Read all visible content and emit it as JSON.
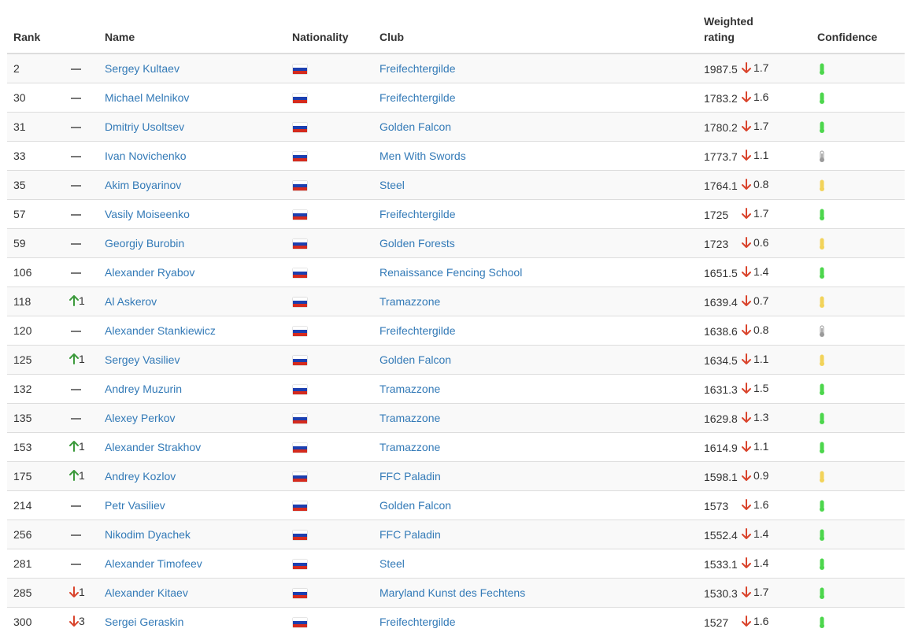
{
  "headers": {
    "rank": "Rank",
    "name": "Name",
    "nationality": "Nationality",
    "club": "Club",
    "weighted_line1": "Weighted",
    "weighted_line2": "rating",
    "confidence": "Confidence"
  },
  "colors": {
    "link": "#337ab7",
    "up": "#3c9a3c",
    "down": "#d9442c",
    "neutral": "#777777",
    "confidence_high": "#4cd64c",
    "confidence_medium": "#f2d35a",
    "confidence_unknown": "#9a9a9a"
  },
  "rows": [
    {
      "rank": "2",
      "change_dir": "none",
      "change": "",
      "name": "Sergey Kultaev",
      "flag": "russia-flag-icon",
      "club": "Freifechtergilde",
      "rating": "1987.5",
      "rating_change": "1.7",
      "confidence": "high"
    },
    {
      "rank": "30",
      "change_dir": "none",
      "change": "",
      "name": "Michael Melnikov",
      "flag": "russia-flag-icon",
      "club": "Freifechtergilde",
      "rating": "1783.2",
      "rating_change": "1.6",
      "confidence": "high"
    },
    {
      "rank": "31",
      "change_dir": "none",
      "change": "",
      "name": "Dmitriy Usoltsev",
      "flag": "russia-flag-icon",
      "club": "Golden Falcon",
      "rating": "1780.2",
      "rating_change": "1.7",
      "confidence": "high"
    },
    {
      "rank": "33",
      "change_dir": "none",
      "change": "",
      "name": "Ivan Novichenko",
      "flag": "russia-flag-icon",
      "club": "Men With Swords",
      "rating": "1773.7",
      "rating_change": "1.1",
      "confidence": "unknown"
    },
    {
      "rank": "35",
      "change_dir": "none",
      "change": "",
      "name": "Akim Boyarinov",
      "flag": "russia-flag-icon",
      "club": "Steel",
      "rating": "1764.1",
      "rating_change": "0.8",
      "confidence": "medium"
    },
    {
      "rank": "57",
      "change_dir": "none",
      "change": "",
      "name": "Vasily Moiseenko",
      "flag": "russia-flag-icon",
      "club": "Freifechtergilde",
      "rating": "1725",
      "rating_change": "1.7",
      "confidence": "high"
    },
    {
      "rank": "59",
      "change_dir": "none",
      "change": "",
      "name": "Georgiy Burobin",
      "flag": "russia-flag-icon",
      "club": "Golden Forests",
      "rating": "1723",
      "rating_change": "0.6",
      "confidence": "medium"
    },
    {
      "rank": "106",
      "change_dir": "none",
      "change": "",
      "name": "Alexander Ryabov",
      "flag": "russia-flag-icon",
      "club": "Renaissance Fencing School",
      "rating": "1651.5",
      "rating_change": "1.4",
      "confidence": "high"
    },
    {
      "rank": "118",
      "change_dir": "up",
      "change": "1",
      "name": "Al Askerov",
      "flag": "russia-flag-icon",
      "club": "Tramazzone",
      "rating": "1639.4",
      "rating_change": "0.7",
      "confidence": "medium"
    },
    {
      "rank": "120",
      "change_dir": "none",
      "change": "",
      "name": "Alexander Stankiewicz",
      "flag": "russia-flag-icon",
      "club": "Freifechtergilde",
      "rating": "1638.6",
      "rating_change": "0.8",
      "confidence": "unknown"
    },
    {
      "rank": "125",
      "change_dir": "up",
      "change": "1",
      "name": "Sergey Vasiliev",
      "flag": "russia-flag-icon",
      "club": "Golden Falcon",
      "rating": "1634.5",
      "rating_change": "1.1",
      "confidence": "medium"
    },
    {
      "rank": "132",
      "change_dir": "none",
      "change": "",
      "name": "Andrey Muzurin",
      "flag": "russia-flag-icon",
      "club": "Tramazzone",
      "rating": "1631.3",
      "rating_change": "1.5",
      "confidence": "high"
    },
    {
      "rank": "135",
      "change_dir": "none",
      "change": "",
      "name": "Alexey Perkov",
      "flag": "russia-flag-icon",
      "club": "Tramazzone",
      "rating": "1629.8",
      "rating_change": "1.3",
      "confidence": "high"
    },
    {
      "rank": "153",
      "change_dir": "up",
      "change": "1",
      "name": "Alexander Strakhov",
      "flag": "russia-flag-icon",
      "club": "Tramazzone",
      "rating": "1614.9",
      "rating_change": "1.1",
      "confidence": "high"
    },
    {
      "rank": "175",
      "change_dir": "up",
      "change": "1",
      "name": "Andrey Kozlov",
      "flag": "russia-flag-icon",
      "club": "FFC Paladin",
      "rating": "1598.1",
      "rating_change": "0.9",
      "confidence": "medium"
    },
    {
      "rank": "214",
      "change_dir": "none",
      "change": "",
      "name": "Petr Vasiliev",
      "flag": "russia-flag-icon",
      "club": "Golden Falcon",
      "rating": "1573",
      "rating_change": "1.6",
      "confidence": "high"
    },
    {
      "rank": "256",
      "change_dir": "none",
      "change": "",
      "name": "Nikodim Dyachek",
      "flag": "russia-flag-icon",
      "club": "FFC Paladin",
      "rating": "1552.4",
      "rating_change": "1.4",
      "confidence": "high"
    },
    {
      "rank": "281",
      "change_dir": "none",
      "change": "",
      "name": "Alexander Timofeev",
      "flag": "russia-flag-icon",
      "club": "Steel",
      "rating": "1533.1",
      "rating_change": "1.4",
      "confidence": "high"
    },
    {
      "rank": "285",
      "change_dir": "down",
      "change": "1",
      "name": "Alexander Kitaev",
      "flag": "russia-flag-icon",
      "club": "Maryland Kunst des Fechtens",
      "rating": "1530.3",
      "rating_change": "1.7",
      "confidence": "high"
    },
    {
      "rank": "300",
      "change_dir": "down",
      "change": "3",
      "name": "Sergei Geraskin",
      "flag": "russia-flag-icon",
      "club": "Freifechtergilde",
      "rating": "1527",
      "rating_change": "1.6",
      "confidence": "high"
    }
  ]
}
